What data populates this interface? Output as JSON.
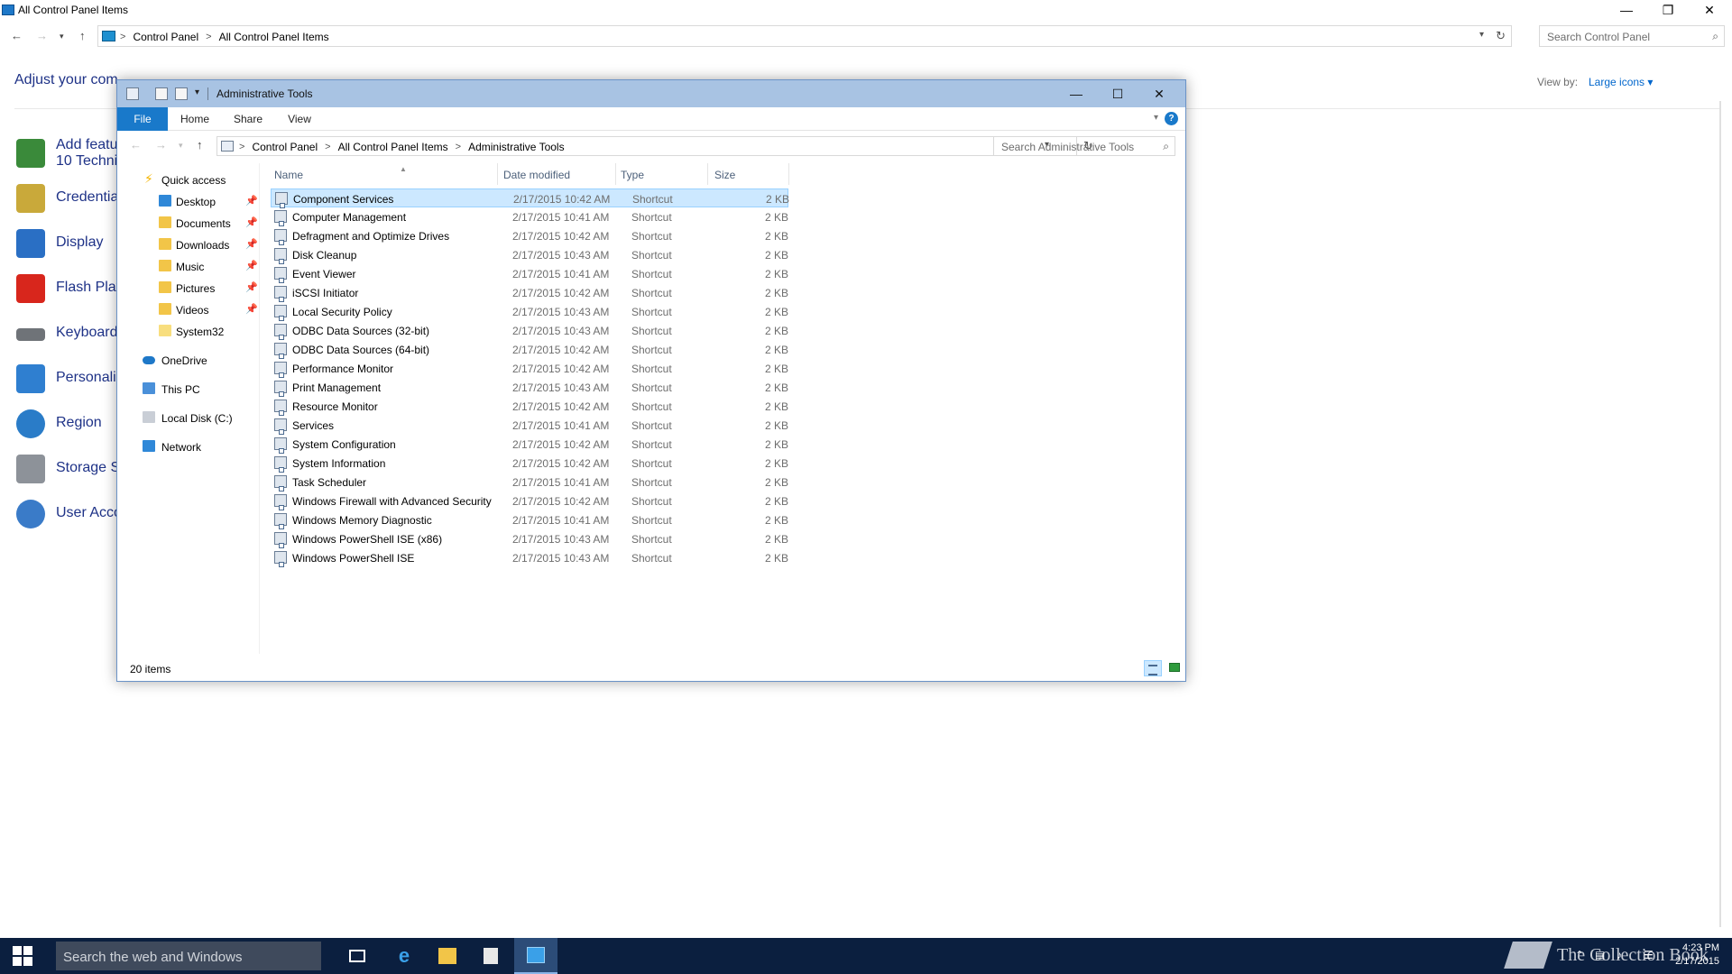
{
  "control_panel": {
    "title": "All Control Panel Items",
    "window_controls": {
      "minimize": "—",
      "restore": "❐",
      "close": "✕"
    },
    "breadcrumb": [
      "Control Panel",
      "All Control Panel Items"
    ],
    "search_placeholder": "Search Control Panel",
    "heading": "Adjust your com",
    "view_by_label": "View by:",
    "view_by_value": "Large icons ▾",
    "items": [
      {
        "label": "Add featu\n10 Techni",
        "icon": "add-features-icon",
        "color": "#3a8a3a"
      },
      {
        "label": "Credentia",
        "icon": "credential-manager-icon",
        "color": "#c9a93a"
      },
      {
        "label": "Display",
        "icon": "display-icon",
        "color": "#2a6fc4"
      },
      {
        "label": "Flash Play",
        "icon": "flash-player-icon",
        "color": "#d8261c"
      },
      {
        "label": "Keyboard",
        "icon": "keyboard-icon",
        "color": "#6f7378"
      },
      {
        "label": "Personaliz",
        "icon": "personalization-icon",
        "color": "#2f7fd0"
      },
      {
        "label": "Region",
        "icon": "region-icon",
        "color": "#2a7cc8"
      },
      {
        "label": "Storage S",
        "icon": "storage-spaces-icon",
        "color": "#8d9299"
      },
      {
        "label": "User Acco",
        "icon": "user-accounts-icon",
        "color": "#3a7bc8"
      }
    ]
  },
  "admin_tools": {
    "title": "Administrative Tools",
    "window_controls": {
      "minimize": "—",
      "maximize": "☐",
      "close": "✕"
    },
    "ribbon_tabs": [
      "File",
      "Home",
      "Share",
      "View"
    ],
    "help": "?",
    "breadcrumb": [
      "Control Panel",
      "All Control Panel Items",
      "Administrative Tools"
    ],
    "search_placeholder": "Search Administrative Tools",
    "nav": {
      "quick_access": "Quick access",
      "pinned": [
        "Desktop",
        "Documents",
        "Downloads",
        "Music",
        "Pictures",
        "Videos"
      ],
      "system32": "System32",
      "onedrive": "OneDrive",
      "this_pc": "This PC",
      "local_disk": "Local Disk (C:)",
      "network": "Network"
    },
    "columns": {
      "name": "Name",
      "date": "Date modified",
      "type": "Type",
      "size": "Size"
    },
    "files": [
      {
        "name": "Component Services",
        "date": "2/17/2015 10:42 AM",
        "type": "Shortcut",
        "size": "2 KB",
        "selected": true
      },
      {
        "name": "Computer Management",
        "date": "2/17/2015 10:41 AM",
        "type": "Shortcut",
        "size": "2 KB"
      },
      {
        "name": "Defragment and Optimize Drives",
        "date": "2/17/2015 10:42 AM",
        "type": "Shortcut",
        "size": "2 KB"
      },
      {
        "name": "Disk Cleanup",
        "date": "2/17/2015 10:43 AM",
        "type": "Shortcut",
        "size": "2 KB"
      },
      {
        "name": "Event Viewer",
        "date": "2/17/2015 10:41 AM",
        "type": "Shortcut",
        "size": "2 KB"
      },
      {
        "name": "iSCSI Initiator",
        "date": "2/17/2015 10:42 AM",
        "type": "Shortcut",
        "size": "2 KB"
      },
      {
        "name": "Local Security Policy",
        "date": "2/17/2015 10:43 AM",
        "type": "Shortcut",
        "size": "2 KB"
      },
      {
        "name": "ODBC Data Sources (32-bit)",
        "date": "2/17/2015 10:43 AM",
        "type": "Shortcut",
        "size": "2 KB"
      },
      {
        "name": "ODBC Data Sources (64-bit)",
        "date": "2/17/2015 10:42 AM",
        "type": "Shortcut",
        "size": "2 KB"
      },
      {
        "name": "Performance Monitor",
        "date": "2/17/2015 10:42 AM",
        "type": "Shortcut",
        "size": "2 KB"
      },
      {
        "name": "Print Management",
        "date": "2/17/2015 10:43 AM",
        "type": "Shortcut",
        "size": "2 KB"
      },
      {
        "name": "Resource Monitor",
        "date": "2/17/2015 10:42 AM",
        "type": "Shortcut",
        "size": "2 KB"
      },
      {
        "name": "Services",
        "date": "2/17/2015 10:41 AM",
        "type": "Shortcut",
        "size": "2 KB"
      },
      {
        "name": "System Configuration",
        "date": "2/17/2015 10:42 AM",
        "type": "Shortcut",
        "size": "2 KB"
      },
      {
        "name": "System Information",
        "date": "2/17/2015 10:42 AM",
        "type": "Shortcut",
        "size": "2 KB"
      },
      {
        "name": "Task Scheduler",
        "date": "2/17/2015 10:41 AM",
        "type": "Shortcut",
        "size": "2 KB"
      },
      {
        "name": "Windows Firewall with Advanced Security",
        "date": "2/17/2015 10:42 AM",
        "type": "Shortcut",
        "size": "2 KB"
      },
      {
        "name": "Windows Memory Diagnostic",
        "date": "2/17/2015 10:41 AM",
        "type": "Shortcut",
        "size": "2 KB"
      },
      {
        "name": "Windows PowerShell ISE (x86)",
        "date": "2/17/2015 10:43 AM",
        "type": "Shortcut",
        "size": "2 KB"
      },
      {
        "name": "Windows PowerShell ISE",
        "date": "2/17/2015 10:43 AM",
        "type": "Shortcut",
        "size": "2 KB"
      }
    ],
    "status": "20 items"
  },
  "taskbar": {
    "search_placeholder": "Search the web and Windows",
    "apps": [
      {
        "name": "task-view-icon",
        "color": "#ffffff"
      },
      {
        "name": "internet-explorer-icon",
        "color": "#3aa0e8"
      },
      {
        "name": "file-explorer-icon",
        "color": "#f2c548"
      },
      {
        "name": "store-icon",
        "color": "#e8e8e8"
      },
      {
        "name": "control-panel-icon",
        "color": "#3aa0e8"
      }
    ],
    "watermark": "The Collection Book",
    "time": "4:23 PM",
    "date": "2/17/2015"
  }
}
